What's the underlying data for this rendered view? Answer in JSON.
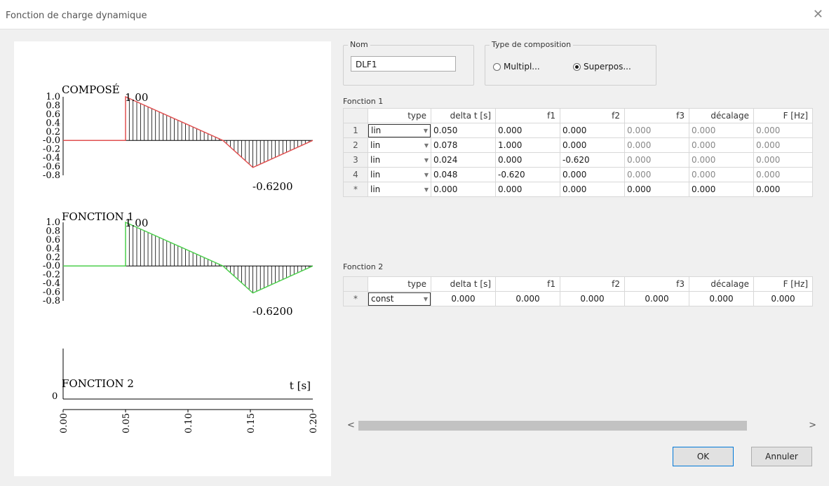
{
  "window": {
    "title": "Fonction de charge dynamique",
    "close_glyph": "✕"
  },
  "nom": {
    "label": "Nom",
    "value": "DLF1"
  },
  "composition": {
    "label": "Type de composition",
    "options": [
      {
        "label": "Multipl...",
        "selected": false
      },
      {
        "label": "Superpos...",
        "selected": true
      }
    ]
  },
  "fonction1": {
    "label": "Fonction 1",
    "columns": [
      "type",
      "delta t [s]",
      "f1",
      "f2",
      "f3",
      "décalage",
      "F [Hz]"
    ],
    "rows": [
      {
        "hdr": "1",
        "type": "lin",
        "dt": "0.050",
        "f1": "0.000",
        "f2": "0.000",
        "f3": "0.000",
        "dec": "0.000",
        "fhz": "0.000"
      },
      {
        "hdr": "2",
        "type": "lin",
        "dt": "0.078",
        "f1": "1.000",
        "f2": "0.000",
        "f3": "0.000",
        "dec": "0.000",
        "fhz": "0.000"
      },
      {
        "hdr": "3",
        "type": "lin",
        "dt": "0.024",
        "f1": "0.000",
        "f2": "-0.620",
        "f3": "0.000",
        "dec": "0.000",
        "fhz": "0.000"
      },
      {
        "hdr": "4",
        "type": "lin",
        "dt": "0.048",
        "f1": "-0.620",
        "f2": "0.000",
        "f3": "0.000",
        "dec": "0.000",
        "fhz": "0.000"
      },
      {
        "hdr": "*",
        "type": "lin",
        "dt": "0.000",
        "f1": "0.000",
        "f2": "0.000",
        "f3": "0.000",
        "dec": "0.000",
        "fhz": "0.000"
      }
    ]
  },
  "fonction2": {
    "label": "Fonction 2",
    "columns": [
      "type",
      "delta t [s]",
      "f1",
      "f2",
      "f3",
      "décalage",
      "F [Hz]"
    ],
    "rows": [
      {
        "hdr": "*",
        "type": "const",
        "dt": "0.000",
        "f1": "0.000",
        "f2": "0.000",
        "f3": "0.000",
        "dec": "0.000",
        "fhz": "0.000"
      }
    ]
  },
  "scrollbar": {
    "left_arrow": "<",
    "right_arrow": ">"
  },
  "buttons": {
    "ok": "OK",
    "cancel": "Annuler"
  },
  "plots": {
    "y_ticks": [
      "1.0",
      "0.8",
      "0.6",
      "0.4",
      "0.2",
      "-0.0",
      "-0.2",
      "-0.4",
      "-0.6",
      "-0.8"
    ],
    "composed": {
      "label": "COMPOSÉ",
      "max_label": "1.00",
      "min_label": "-0.6200",
      "color": "#e05050"
    },
    "f1": {
      "label": "FONCTION 1",
      "max_label": "1.00",
      "min_label": "-0.6200",
      "color": "#4ccf4c"
    },
    "f2": {
      "label": "FONCTION 2",
      "zero_label": "0"
    },
    "x_axis": {
      "label": "t [s]",
      "ticks": [
        "0.00",
        "0.05",
        "0.10",
        "0.15",
        "0.20"
      ]
    }
  },
  "chart_data": [
    {
      "type": "line",
      "title": "COMPOSÉ",
      "x": [
        0,
        0.05,
        0.05,
        0.128,
        0.152,
        0.2
      ],
      "y": [
        0,
        0,
        1.0,
        0,
        -0.62,
        0
      ],
      "ylim": [
        -0.8,
        1.0
      ],
      "xlim": [
        0,
        0.2
      ],
      "annotations": [
        "1.00",
        "-0.6200"
      ]
    },
    {
      "type": "line",
      "title": "FONCTION 1",
      "x": [
        0,
        0.05,
        0.05,
        0.128,
        0.152,
        0.2
      ],
      "y": [
        0,
        0,
        1.0,
        0,
        -0.62,
        0
      ],
      "ylim": [
        -0.8,
        1.0
      ],
      "xlim": [
        0,
        0.2
      ],
      "annotations": [
        "1.00",
        "-0.6200"
      ]
    },
    {
      "type": "line",
      "title": "FONCTION 2",
      "x": [
        0,
        0.2
      ],
      "y": [
        0,
        0
      ],
      "xlim": [
        0,
        0.2
      ],
      "xlabel": "t [s]",
      "xticks": [
        "0.00",
        "0.05",
        "0.10",
        "0.15",
        "0.20"
      ]
    }
  ]
}
